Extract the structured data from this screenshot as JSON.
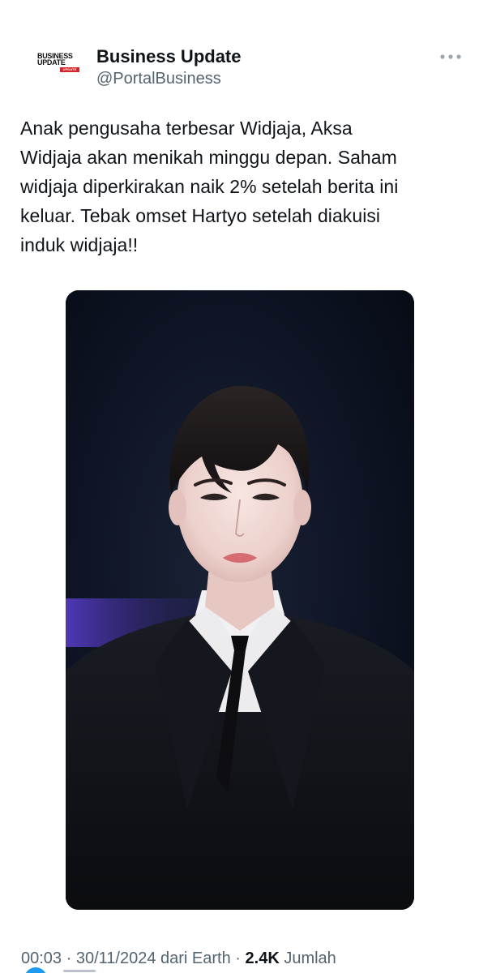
{
  "tweet": {
    "author": {
      "display_name": "Business Update",
      "handle": "@PortalBusiness",
      "avatar": {
        "line1": "BUSINESS",
        "line2": "UPDATE",
        "badge": "UPDATE",
        "badge_color": "#d7262a"
      }
    },
    "more_icon": "more-horizontal-icon",
    "text": "Anak pengusaha terbesar Widjaja, Aksa\nWidjaja akan menikah minggu depan. Saham\nwidjaja diperkirakan naik 2% setelah berita ini\nkeluar. Tebak omset Hartyo setelah diakuisi\ninduk widjaja!!",
    "meta": {
      "time": "00:03",
      "separator1": " · ",
      "date": "30/11/2024",
      "source": " dari Earth",
      "separator2": " · ",
      "views_count": "2.4K",
      "views_label": " Jumlah"
    }
  },
  "colors": {
    "text_primary": "#0f1419",
    "text_secondary": "#536471",
    "accent": "#1d9bf0"
  }
}
